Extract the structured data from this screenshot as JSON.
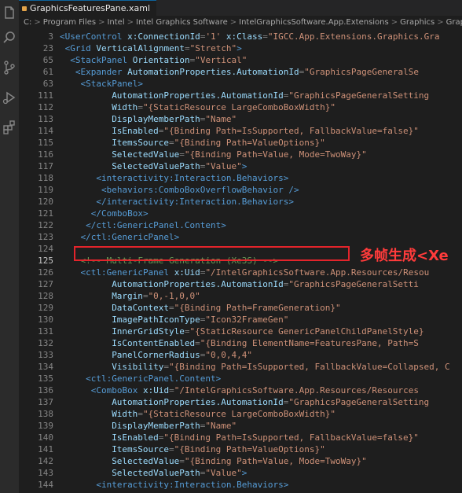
{
  "tab": {
    "title": "GraphicsFeaturesPane.xaml"
  },
  "breadcrumb": [
    "C:",
    "Program Files",
    "Intel",
    "Intel Graphics Software",
    "IntelGraphicsSoftware.App.Extensions",
    "Graphics",
    "GraphicsFeat"
  ],
  "annotation": "多帧生成<Xe",
  "lines": [
    {
      "n": "3",
      "i": 0,
      "tokens": [
        [
          "t",
          "<UserControl "
        ],
        [
          "a",
          "x:ConnectionId"
        ],
        [
          "p",
          "="
        ],
        [
          "s",
          "'1'"
        ],
        [
          "a",
          " x:Class"
        ],
        [
          "p",
          "="
        ],
        [
          "s",
          "\"IGCC.App.Extensions.Graphics.Gra"
        ]
      ]
    },
    {
      "n": "23",
      "i": 1,
      "tokens": [
        [
          "t",
          "<Grid "
        ],
        [
          "a",
          "VerticalAlignment"
        ],
        [
          "p",
          "="
        ],
        [
          "s",
          "\"Stretch\""
        ],
        [
          "t",
          ">"
        ]
      ]
    },
    {
      "n": "65",
      "i": 2,
      "tokens": [
        [
          "t",
          "<StackPanel "
        ],
        [
          "a",
          "Orientation"
        ],
        [
          "p",
          "="
        ],
        [
          "s",
          "\"Vertical\""
        ]
      ]
    },
    {
      "n": "61",
      "i": 3,
      "tokens": [
        [
          "t",
          "<Expander "
        ],
        [
          "a",
          "AutomationProperties.AutomationId"
        ],
        [
          "p",
          "="
        ],
        [
          "s",
          "\"GraphicsPageGeneralSe"
        ]
      ]
    },
    {
      "n": "63",
      "i": 4,
      "tokens": [
        [
          "t",
          "<StackPanel>"
        ]
      ]
    },
    {
      "n": "111",
      "i": 10,
      "tokens": [
        [
          "a",
          "AutomationProperties.AutomationId"
        ],
        [
          "p",
          "="
        ],
        [
          "s",
          "\"GraphicsPageGeneralSetting"
        ]
      ]
    },
    {
      "n": "112",
      "i": 10,
      "tokens": [
        [
          "a",
          "Width"
        ],
        [
          "p",
          "="
        ],
        [
          "s",
          "\"{StaticResource LargeComboBoxWidth}\""
        ]
      ]
    },
    {
      "n": "113",
      "i": 10,
      "tokens": [
        [
          "a",
          "DisplayMemberPath"
        ],
        [
          "p",
          "="
        ],
        [
          "s",
          "\"Name\""
        ]
      ]
    },
    {
      "n": "114",
      "i": 10,
      "tokens": [
        [
          "a",
          "IsEnabled"
        ],
        [
          "p",
          "="
        ],
        [
          "s",
          "\"{Binding Path=IsSupported, FallbackValue=false}\""
        ]
      ]
    },
    {
      "n": "115",
      "i": 10,
      "tokens": [
        [
          "a",
          "ItemsSource"
        ],
        [
          "p",
          "="
        ],
        [
          "s",
          "\"{Binding Path=ValueOptions}\""
        ]
      ]
    },
    {
      "n": "116",
      "i": 10,
      "tokens": [
        [
          "a",
          "SelectedValue"
        ],
        [
          "p",
          "="
        ],
        [
          "s",
          "\"{Binding Path=Value, Mode=TwoWay}\""
        ]
      ]
    },
    {
      "n": "117",
      "i": 10,
      "tokens": [
        [
          "a",
          "SelectedValuePath"
        ],
        [
          "p",
          "="
        ],
        [
          "s",
          "\"Value\""
        ],
        [
          "t",
          ">"
        ]
      ]
    },
    {
      "n": "118",
      "i": 7,
      "tokens": [
        [
          "t",
          "<interactivity:Interaction.Behaviors>"
        ]
      ]
    },
    {
      "n": "119",
      "i": 8,
      "tokens": [
        [
          "t",
          "<behaviors:ComboBoxOverflowBehavior />"
        ]
      ]
    },
    {
      "n": "120",
      "i": 7,
      "tokens": [
        [
          "t",
          "</interactivity:Interaction.Behaviors>"
        ]
      ]
    },
    {
      "n": "121",
      "i": 6,
      "tokens": [
        [
          "t",
          "</ComboBox>"
        ]
      ]
    },
    {
      "n": "122",
      "i": 5,
      "tokens": [
        [
          "t",
          "</ctl:GenericPanel.Content>"
        ]
      ]
    },
    {
      "n": "123",
      "i": 4,
      "tokens": [
        [
          "t",
          "</ctl:GenericPanel>"
        ]
      ]
    },
    {
      "n": "124",
      "i": 0,
      "tokens": []
    },
    {
      "n": "125",
      "i": 4,
      "cur": true,
      "tokens": [
        [
          "c",
          "<!-- Multi-Frame Generation (Xe3S) -->"
        ]
      ]
    },
    {
      "n": "126",
      "i": 4,
      "tokens": [
        [
          "t",
          "<ctl:GenericPanel "
        ],
        [
          "a",
          "x:Uid"
        ],
        [
          "p",
          "="
        ],
        [
          "s",
          "\"/IntelGraphicsSoftware.App.Resources/Resou"
        ]
      ]
    },
    {
      "n": "127",
      "i": 10,
      "tokens": [
        [
          "a",
          "AutomationProperties.AutomationId"
        ],
        [
          "p",
          "="
        ],
        [
          "s",
          "\"GraphicsPageGeneralSetti"
        ]
      ]
    },
    {
      "n": "128",
      "i": 10,
      "tokens": [
        [
          "a",
          "Margin"
        ],
        [
          "p",
          "="
        ],
        [
          "s",
          "\"0,-1,0,0\""
        ]
      ]
    },
    {
      "n": "129",
      "i": 10,
      "tokens": [
        [
          "a",
          "DataContext"
        ],
        [
          "p",
          "="
        ],
        [
          "s",
          "\"{Binding Path=FrameGeneration}\""
        ]
      ]
    },
    {
      "n": "130",
      "i": 10,
      "tokens": [
        [
          "a",
          "ImagePathIconType"
        ],
        [
          "p",
          "="
        ],
        [
          "s",
          "\"Icon32FrameGen\""
        ]
      ]
    },
    {
      "n": "131",
      "i": 10,
      "tokens": [
        [
          "a",
          "InnerGridStyle"
        ],
        [
          "p",
          "="
        ],
        [
          "s",
          "\"{StaticResource GenericPanelChildPanelStyle}"
        ]
      ]
    },
    {
      "n": "132",
      "i": 10,
      "tokens": [
        [
          "a",
          "IsContentEnabled"
        ],
        [
          "p",
          "="
        ],
        [
          "s",
          "\"{Binding ElementName=FeaturesPane, Path=S"
        ]
      ]
    },
    {
      "n": "133",
      "i": 10,
      "tokens": [
        [
          "a",
          "PanelCornerRadius"
        ],
        [
          "p",
          "="
        ],
        [
          "s",
          "\"0,0,4,4\""
        ]
      ]
    },
    {
      "n": "134",
      "i": 10,
      "tokens": [
        [
          "a",
          "Visibility"
        ],
        [
          "p",
          "="
        ],
        [
          "s",
          "\"{Binding Path=IsSupported, FallbackValue=Collapsed, C"
        ]
      ]
    },
    {
      "n": "135",
      "i": 5,
      "tokens": [
        [
          "t",
          "<ctl:GenericPanel.Content>"
        ]
      ]
    },
    {
      "n": "136",
      "i": 6,
      "tokens": [
        [
          "t",
          "<ComboBox "
        ],
        [
          "a",
          "x:Uid"
        ],
        [
          "p",
          "="
        ],
        [
          "s",
          "\"/IntelGraphicsSoftware.App.Resources/Resources"
        ]
      ]
    },
    {
      "n": "137",
      "i": 10,
      "tokens": [
        [
          "a",
          "AutomationProperties.AutomationId"
        ],
        [
          "p",
          "="
        ],
        [
          "s",
          "\"GraphicsPageGeneralSetting"
        ]
      ]
    },
    {
      "n": "138",
      "i": 10,
      "tokens": [
        [
          "a",
          "Width"
        ],
        [
          "p",
          "="
        ],
        [
          "s",
          "\"{StaticResource LargeComboBoxWidth}\""
        ]
      ]
    },
    {
      "n": "139",
      "i": 10,
      "tokens": [
        [
          "a",
          "DisplayMemberPath"
        ],
        [
          "p",
          "="
        ],
        [
          "s",
          "\"Name\""
        ]
      ]
    },
    {
      "n": "140",
      "i": 10,
      "tokens": [
        [
          "a",
          "IsEnabled"
        ],
        [
          "p",
          "="
        ],
        [
          "s",
          "\"{Binding Path=IsSupported, FallbackValue=false}\""
        ]
      ]
    },
    {
      "n": "141",
      "i": 10,
      "tokens": [
        [
          "a",
          "ItemsSource"
        ],
        [
          "p",
          "="
        ],
        [
          "s",
          "\"{Binding Path=ValueOptions}\""
        ]
      ]
    },
    {
      "n": "142",
      "i": 10,
      "tokens": [
        [
          "a",
          "SelectedValue"
        ],
        [
          "p",
          "="
        ],
        [
          "s",
          "\"{Binding Path=Value, Mode=TwoWay}\""
        ]
      ]
    },
    {
      "n": "143",
      "i": 10,
      "tokens": [
        [
          "a",
          "SelectedValuePath"
        ],
        [
          "p",
          "="
        ],
        [
          "s",
          "\"Value\""
        ],
        [
          "t",
          ">"
        ]
      ]
    },
    {
      "n": "144",
      "i": 7,
      "tokens": [
        [
          "t",
          "<interactivity:Interaction.Behaviors>"
        ]
      ]
    },
    {
      "n": "145",
      "i": 8,
      "tokens": [
        [
          "t",
          "<behaviors:ComboBoxOverflowBehavior />"
        ]
      ]
    }
  ]
}
